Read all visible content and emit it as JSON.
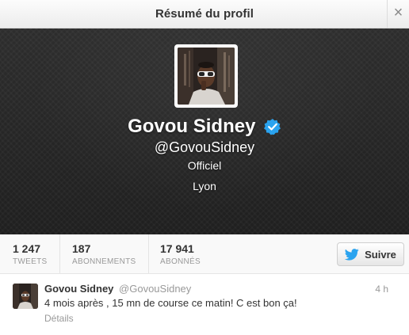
{
  "modal": {
    "title": "Résumé du profil",
    "close_label": "×"
  },
  "profile": {
    "name": "Govou Sidney",
    "handle": "@GovouSidney",
    "bio": "Officiel",
    "location": "Lyon",
    "verified": true,
    "verified_color": "#2aa3ef"
  },
  "stats": [
    {
      "value": "1 247",
      "label": "TWEETS"
    },
    {
      "value": "187",
      "label": "ABONNEMENTS"
    },
    {
      "value": "17 941",
      "label": "ABONNÉS"
    }
  ],
  "follow_button": {
    "label": "Suivre",
    "icon": "twitter-bird-icon",
    "icon_color": "#2aa3ef"
  },
  "tweet": {
    "name": "Govou Sidney",
    "handle": "@GovouSidney",
    "time": "4 h",
    "text": "4 mois après , 15 mn de course ce matin! C est bon ça!",
    "details_label": "Détails"
  }
}
